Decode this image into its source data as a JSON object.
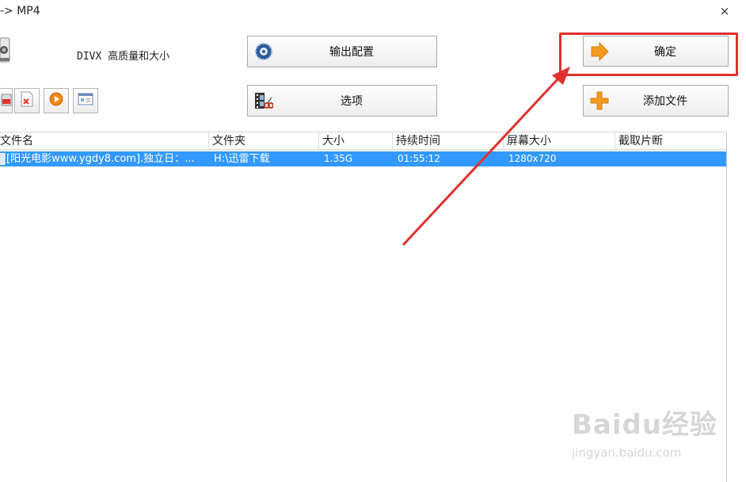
{
  "window": {
    "title": "-> MP4",
    "close_glyph": "×"
  },
  "profile": {
    "label": "DIVX 高质量和大小",
    "icon": "camera-profile-icon"
  },
  "buttons": {
    "output_config": {
      "label": "输出配置",
      "icon": "gear-disc-icon"
    },
    "options": {
      "label": "选项",
      "icon": "film-scissors-icon"
    },
    "ok": {
      "label": "确定",
      "icon": "orange-arrow-right-icon"
    },
    "add_file": {
      "label": "添加文件",
      "icon": "orange-plus-icon"
    }
  },
  "toolbar": {
    "items": [
      {
        "icon": "remove-icon"
      },
      {
        "icon": "delete-file-icon"
      },
      {
        "icon": "play-icon"
      },
      {
        "icon": "info-card-icon"
      }
    ]
  },
  "table": {
    "columns": [
      "文件名",
      "文件夹",
      "大小",
      "持续时间",
      "屏幕大小",
      "截取片断"
    ],
    "rows": [
      {
        "name": "[阳光电影www.ygdy8.com].独立日：...",
        "folder": "H:\\迅雷下载",
        "size": "1.35G",
        "duration": "01:55:12",
        "resolution": "1280x720",
        "clip": ""
      }
    ]
  },
  "annotation": {
    "color": "#e0302e"
  },
  "watermark": {
    "logo": "Baidu经验",
    "url": "jingyan.baidu.com"
  },
  "colors": {
    "selection": "#3399ff",
    "accent_orange": "#f39a1e"
  }
}
